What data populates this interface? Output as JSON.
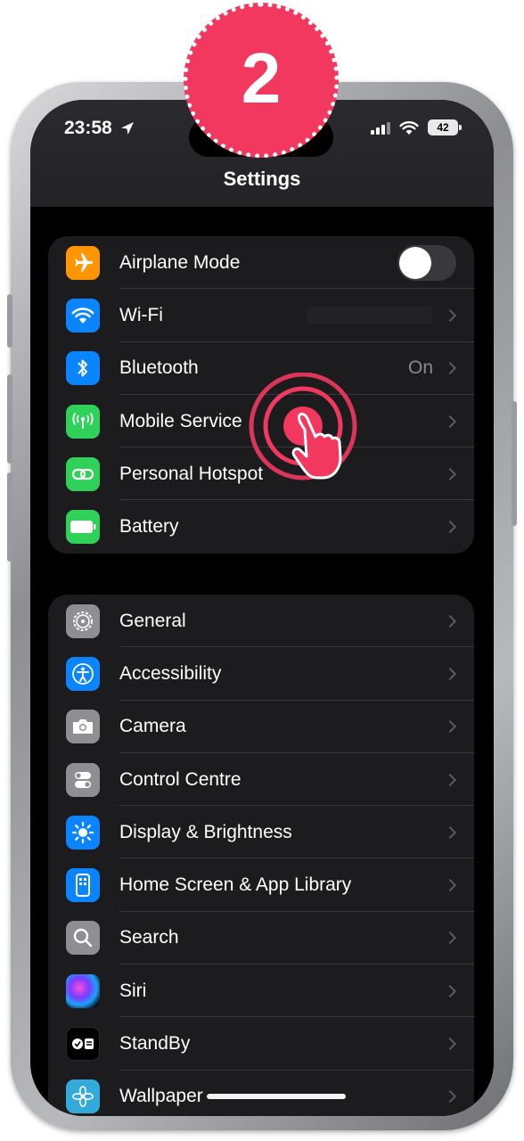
{
  "status_bar": {
    "time": "23:58",
    "battery": "42"
  },
  "nav": {
    "title": "Settings"
  },
  "step_badge": "2",
  "groups": [
    {
      "items": [
        {
          "label": "Airplane Mode",
          "icon": "airplane-icon",
          "color": "#ff9500",
          "accessory": "toggle",
          "toggle_on": false
        },
        {
          "label": "Wi-Fi",
          "icon": "wifi-icon",
          "color": "#0a84ff",
          "accessory": "chevron",
          "value": ""
        },
        {
          "label": "Bluetooth",
          "icon": "bluetooth-icon",
          "color": "#0a84ff",
          "accessory": "chevron",
          "value": "On"
        },
        {
          "label": "Mobile Service",
          "icon": "antenna-icon",
          "color": "#30d158",
          "accessory": "chevron"
        },
        {
          "label": "Personal Hotspot",
          "icon": "link-icon",
          "color": "#30d158",
          "accessory": "chevron"
        },
        {
          "label": "Battery",
          "icon": "battery-icon",
          "color": "#30d158",
          "accessory": "chevron"
        }
      ]
    },
    {
      "items": [
        {
          "label": "General",
          "icon": "gear-icon",
          "color": "#8e8e93",
          "accessory": "chevron"
        },
        {
          "label": "Accessibility",
          "icon": "accessibility-icon",
          "color": "#0a84ff",
          "accessory": "chevron"
        },
        {
          "label": "Camera",
          "icon": "camera-icon",
          "color": "#8e8e93",
          "accessory": "chevron"
        },
        {
          "label": "Control Centre",
          "icon": "toggles-icon",
          "color": "#8e8e93",
          "accessory": "chevron"
        },
        {
          "label": "Display & Brightness",
          "icon": "sun-icon",
          "color": "#0a84ff",
          "accessory": "chevron"
        },
        {
          "label": "Home Screen & App Library",
          "icon": "phone-grid-icon",
          "color": "#0a84ff",
          "accessory": "chevron"
        },
        {
          "label": "Search",
          "icon": "magnifier-icon",
          "color": "#8e8e93",
          "accessory": "chevron"
        },
        {
          "label": "Siri",
          "icon": "siri-icon",
          "color": "#1c1c1e",
          "accessory": "chevron"
        },
        {
          "label": "StandBy",
          "icon": "standby-icon",
          "color": "#000000",
          "accessory": "chevron"
        },
        {
          "label": "Wallpaper",
          "icon": "flower-icon",
          "color": "#34aadc",
          "accessory": "chevron"
        }
      ]
    }
  ]
}
